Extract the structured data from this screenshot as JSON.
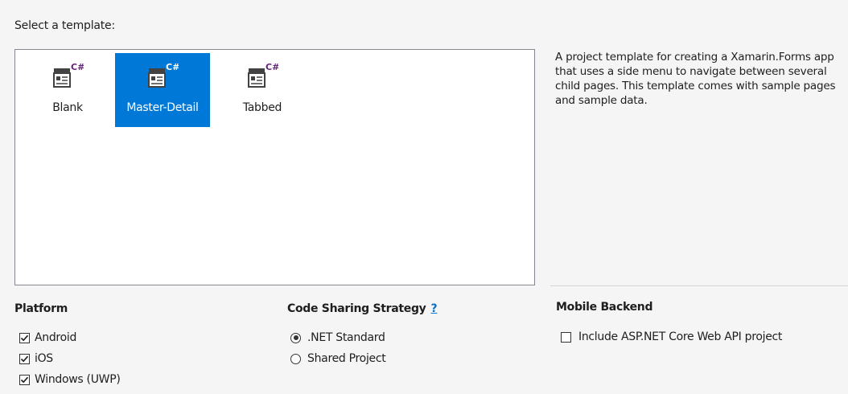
{
  "select_template_label": "Select a template:",
  "templates": [
    {
      "label": "Blank",
      "selected": false
    },
    {
      "label": "Master-Detail",
      "selected": true
    },
    {
      "label": "Tabbed",
      "selected": false
    }
  ],
  "template_icon_badge": "C#",
  "description": "A project template for creating a Xamarin.Forms app that uses a side menu to navigate between several child pages. This template comes with sample pages and sample data.",
  "platform": {
    "heading": "Platform",
    "options": [
      {
        "label": "Android",
        "checked": true
      },
      {
        "label": "iOS",
        "checked": true
      },
      {
        "label": "Windows (UWP)",
        "checked": true
      }
    ]
  },
  "code_sharing": {
    "heading": "Code Sharing Strategy",
    "help": "?",
    "options": [
      {
        "label": ".NET Standard",
        "selected": true
      },
      {
        "label": "Shared Project",
        "selected": false
      }
    ]
  },
  "mobile_backend": {
    "heading": "Mobile Backend",
    "options": [
      {
        "label": "Include ASP.NET Core Web API project",
        "checked": false
      }
    ]
  },
  "colors": {
    "selection": "#0078d7",
    "link": "#0e70c0",
    "badge": "#68217a"
  }
}
